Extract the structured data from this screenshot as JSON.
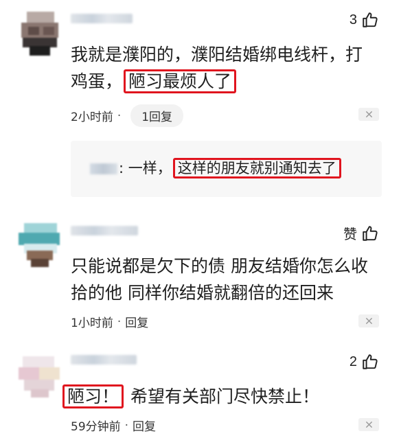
{
  "comments": [
    {
      "like_count": "3",
      "text_line1": "我就是濮阳的，濮阳结婚绑电线杆，打",
      "text_line2_plain": "鸡蛋，",
      "text_line2_highlight": "陋习最烦人了",
      "time": "2小时前",
      "reply_label": "1回复",
      "sub_reply": {
        "prefix": ": 一样，",
        "highlight": "这样的朋友就别通知去了"
      }
    },
    {
      "like_count": "赞",
      "text_line1": "只能说都是欠下的债 朋友结婚你怎么收",
      "text_line2": "拾的他 同样你结婚就翻倍的还回来",
      "time": "1小时前",
      "reply_label": "回复"
    },
    {
      "like_count": "2",
      "text_highlight": "陋习！",
      "text_rest": "希望有关部门尽快禁止！",
      "time": "59分钟前",
      "reply_label": "回复"
    }
  ],
  "meta_separator": "·",
  "icons": {
    "like": "thumbs-up-icon",
    "close": "close-icon"
  },
  "colors": {
    "highlight_border": "#e0141e",
    "text": "#1f1f1f",
    "meta": "#333333",
    "pill_bg": "#f2f2f2"
  }
}
